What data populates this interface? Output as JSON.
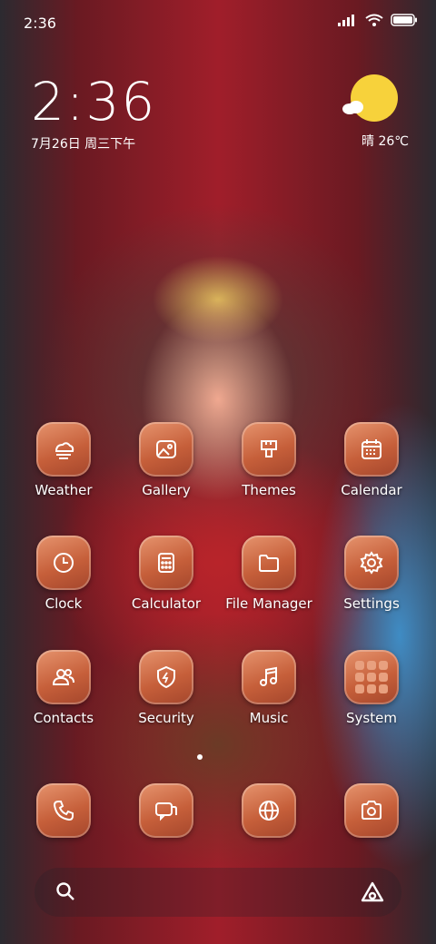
{
  "status_bar": {
    "time": "2:36"
  },
  "clock_widget": {
    "time": "2:36",
    "date": "7月26日 周三下午"
  },
  "weather_widget": {
    "condition_temp": "晴 26℃"
  },
  "apps": [
    {
      "label": "Weather",
      "icon": "weather-icon"
    },
    {
      "label": "Gallery",
      "icon": "gallery-icon"
    },
    {
      "label": "Themes",
      "icon": "themes-icon"
    },
    {
      "label": "Calendar",
      "icon": "calendar-icon"
    },
    {
      "label": "Clock",
      "icon": "clock-icon"
    },
    {
      "label": "Calculator",
      "icon": "calculator-icon"
    },
    {
      "label": "File Manager",
      "icon": "folder-icon"
    },
    {
      "label": "Settings",
      "icon": "gear-icon"
    },
    {
      "label": "Contacts",
      "icon": "contacts-icon"
    },
    {
      "label": "Security",
      "icon": "shield-icon"
    },
    {
      "label": "Music",
      "icon": "music-icon"
    },
    {
      "label": "System",
      "icon": "folder-grid-icon"
    }
  ],
  "dock": [
    {
      "icon": "phone-icon"
    },
    {
      "icon": "messages-icon"
    },
    {
      "icon": "browser-icon"
    },
    {
      "icon": "camera-icon"
    }
  ],
  "search_bar": {
    "left_icon": "search-icon",
    "right_icon": "assistant-icon"
  },
  "colors": {
    "icon_bg": "#c65f3a",
    "sun": "#f7d23b"
  }
}
